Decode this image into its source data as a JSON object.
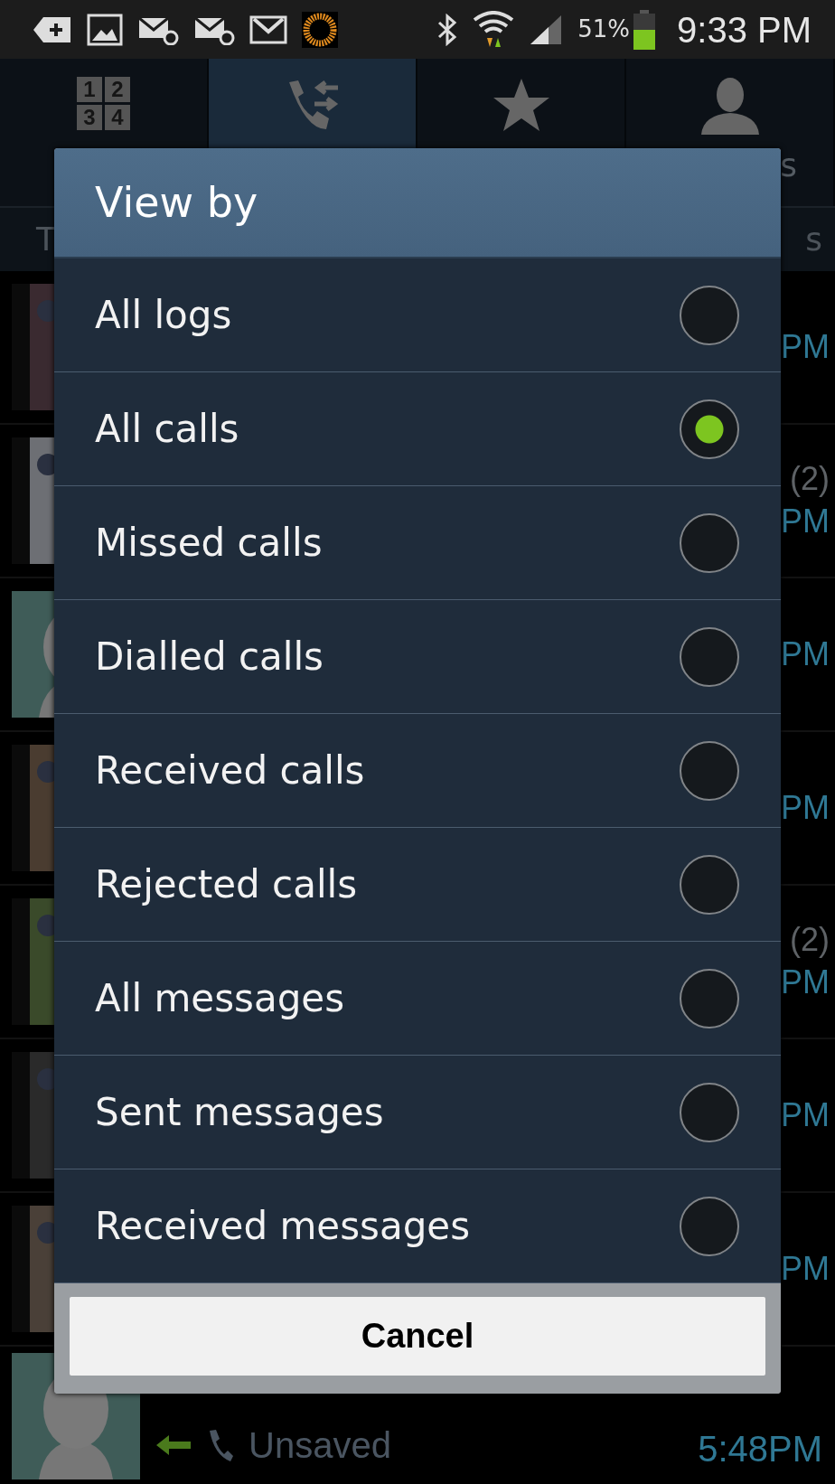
{
  "status_bar": {
    "battery_text": "51%",
    "time": "9:33 PM"
  },
  "tabs": [
    {
      "kind": "keypad",
      "selected": false,
      "digits": [
        "1",
        "2",
        "3",
        "4"
      ]
    },
    {
      "kind": "logs",
      "selected": true
    },
    {
      "kind": "favourites",
      "selected": false
    },
    {
      "kind": "contacts",
      "selected": false,
      "label": "s"
    }
  ],
  "subheader": {
    "left": "T",
    "right": "s"
  },
  "log_rows": [
    {
      "time": "PM"
    },
    {
      "count": "(2)",
      "time": "PM"
    },
    {
      "time": "PM"
    },
    {
      "time": "PM"
    },
    {
      "count": "(2)",
      "time": "PM"
    },
    {
      "time": "PM"
    },
    {
      "time": "PM"
    },
    {
      "label": "Unsaved",
      "time": "5:48PM"
    }
  ],
  "dialog": {
    "title": "View by",
    "options": [
      {
        "label": "All logs",
        "selected": false
      },
      {
        "label": "All calls",
        "selected": true
      },
      {
        "label": "Missed calls",
        "selected": false
      },
      {
        "label": "Dialled calls",
        "selected": false
      },
      {
        "label": "Received calls",
        "selected": false
      },
      {
        "label": "Rejected calls",
        "selected": false
      },
      {
        "label": "All messages",
        "selected": false
      },
      {
        "label": "Sent messages",
        "selected": false
      },
      {
        "label": "Received messages",
        "selected": false
      }
    ],
    "cancel": "Cancel"
  }
}
